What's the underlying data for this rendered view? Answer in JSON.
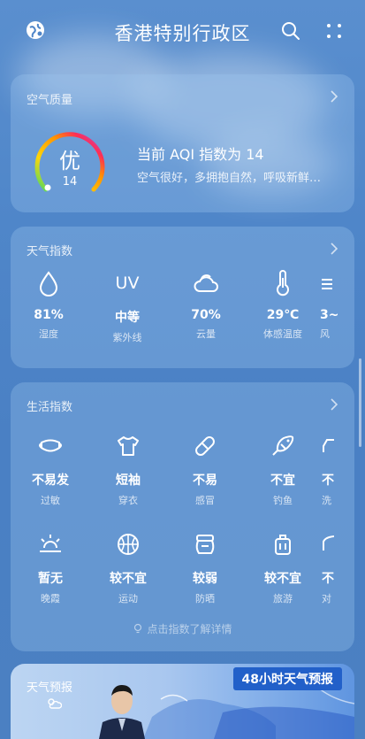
{
  "header": {
    "title": "香港特别行政区"
  },
  "aqi": {
    "title": "空气质量",
    "grade": "优",
    "value": "14",
    "headline": "当前 AQI 指数为 14",
    "advice": "空气很好，多拥抱自然，呼吸新鲜…",
    "level": 0.07
  },
  "weather_index": {
    "title": "天气指数",
    "items": [
      {
        "icon": "drop-icon",
        "value": "81%",
        "label": "湿度"
      },
      {
        "icon": "uv-icon",
        "value": "中等",
        "label": "紫外线"
      },
      {
        "icon": "cloud-icon",
        "value": "70%",
        "label": "云量"
      },
      {
        "icon": "thermometer-icon",
        "value": "29℃",
        "label": "体感温度"
      },
      {
        "icon": "wind-icon",
        "value": "3~",
        "label": "风"
      }
    ],
    "uv_text": "UV"
  },
  "life_index": {
    "title": "生活指数",
    "row1": [
      {
        "icon": "mask-icon",
        "value": "不易发",
        "label": "过敏"
      },
      {
        "icon": "shirt-icon",
        "value": "短袖",
        "label": "穿衣"
      },
      {
        "icon": "pill-icon",
        "value": "不易",
        "label": "感冒"
      },
      {
        "icon": "fish-icon",
        "value": "不宜",
        "label": "钓鱼"
      },
      {
        "icon": "car-icon",
        "value": "不",
        "label": "洗"
      }
    ],
    "row2": [
      {
        "icon": "sunset-icon",
        "value": "暂无",
        "label": "晚霞"
      },
      {
        "icon": "ball-icon",
        "value": "较不宜",
        "label": "运动"
      },
      {
        "icon": "sunscreen-icon",
        "value": "较弱",
        "label": "防晒"
      },
      {
        "icon": "luggage-icon",
        "value": "较不宜",
        "label": "旅游"
      },
      {
        "icon": "umbrella-icon",
        "value": "不",
        "label": "对"
      }
    ],
    "hint": "点击指数了解详情"
  },
  "forecast": {
    "title": "天气预报",
    "badge": "48小时天气预报"
  },
  "colors": {
    "accent": "#4a80c4",
    "badge": "#2260c9"
  }
}
